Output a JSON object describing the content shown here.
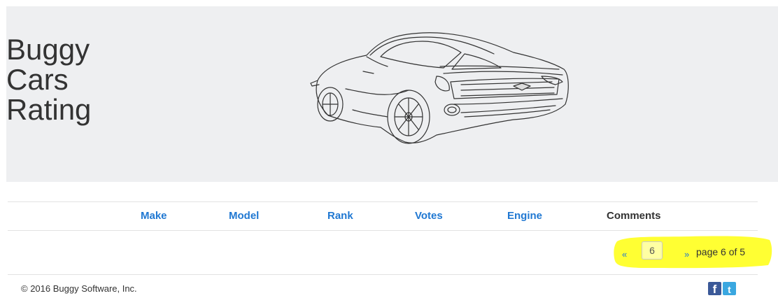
{
  "brand": {
    "title_lines": [
      "Buggy",
      "Cars",
      "Rating"
    ]
  },
  "table": {
    "headers": [
      {
        "label": "Make",
        "sortable": true
      },
      {
        "label": "Model",
        "sortable": true
      },
      {
        "label": "Rank",
        "sortable": true
      },
      {
        "label": "Votes",
        "sortable": true
      },
      {
        "label": "Engine",
        "sortable": true
      },
      {
        "label": "Comments",
        "sortable": false
      }
    ],
    "rows": []
  },
  "pagination": {
    "prev": "«",
    "next": "»",
    "current_page_value": "6",
    "page_count_text": "page 6 of 5",
    "highlight_color": "#ffff33"
  },
  "footer": {
    "copyright": "© 2016 Buggy Software, Inc.",
    "social": [
      {
        "icon": "facebook-icon",
        "glyph": "f"
      },
      {
        "icon": "twitter-icon",
        "glyph": "t"
      }
    ]
  },
  "colors": {
    "link": "#2078d2",
    "hero_bg": "#eeeff1",
    "text": "#333333"
  }
}
